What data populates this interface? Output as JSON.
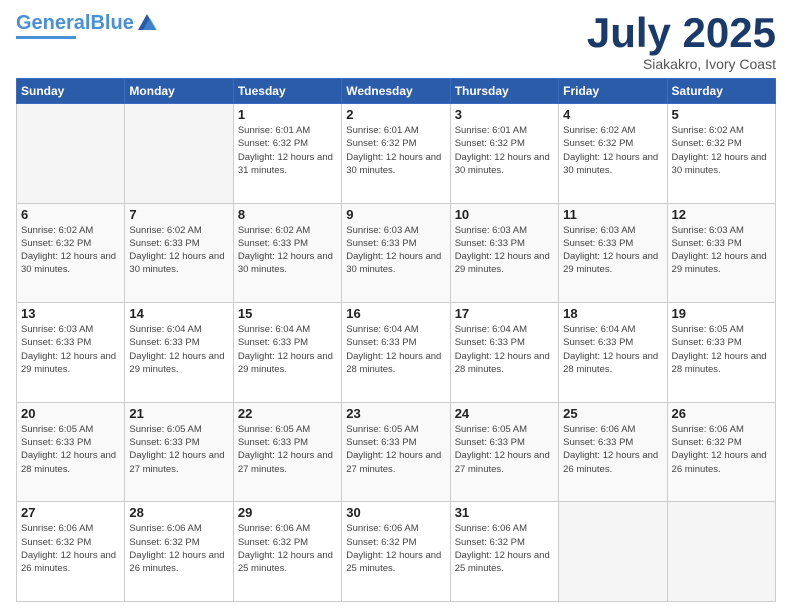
{
  "header": {
    "logo_general": "General",
    "logo_blue": "Blue",
    "month_title": "July 2025",
    "location": "Siakakro, Ivory Coast"
  },
  "days_of_week": [
    "Sunday",
    "Monday",
    "Tuesday",
    "Wednesday",
    "Thursday",
    "Friday",
    "Saturday"
  ],
  "weeks": [
    [
      {
        "day": "",
        "info": ""
      },
      {
        "day": "",
        "info": ""
      },
      {
        "day": "1",
        "sunrise": "6:01 AM",
        "sunset": "6:32 PM",
        "daylight": "12 hours and 31 minutes."
      },
      {
        "day": "2",
        "sunrise": "6:01 AM",
        "sunset": "6:32 PM",
        "daylight": "12 hours and 30 minutes."
      },
      {
        "day": "3",
        "sunrise": "6:01 AM",
        "sunset": "6:32 PM",
        "daylight": "12 hours and 30 minutes."
      },
      {
        "day": "4",
        "sunrise": "6:02 AM",
        "sunset": "6:32 PM",
        "daylight": "12 hours and 30 minutes."
      },
      {
        "day": "5",
        "sunrise": "6:02 AM",
        "sunset": "6:32 PM",
        "daylight": "12 hours and 30 minutes."
      }
    ],
    [
      {
        "day": "6",
        "sunrise": "6:02 AM",
        "sunset": "6:32 PM",
        "daylight": "12 hours and 30 minutes."
      },
      {
        "day": "7",
        "sunrise": "6:02 AM",
        "sunset": "6:33 PM",
        "daylight": "12 hours and 30 minutes."
      },
      {
        "day": "8",
        "sunrise": "6:02 AM",
        "sunset": "6:33 PM",
        "daylight": "12 hours and 30 minutes."
      },
      {
        "day": "9",
        "sunrise": "6:03 AM",
        "sunset": "6:33 PM",
        "daylight": "12 hours and 30 minutes."
      },
      {
        "day": "10",
        "sunrise": "6:03 AM",
        "sunset": "6:33 PM",
        "daylight": "12 hours and 29 minutes."
      },
      {
        "day": "11",
        "sunrise": "6:03 AM",
        "sunset": "6:33 PM",
        "daylight": "12 hours and 29 minutes."
      },
      {
        "day": "12",
        "sunrise": "6:03 AM",
        "sunset": "6:33 PM",
        "daylight": "12 hours and 29 minutes."
      }
    ],
    [
      {
        "day": "13",
        "sunrise": "6:03 AM",
        "sunset": "6:33 PM",
        "daylight": "12 hours and 29 minutes."
      },
      {
        "day": "14",
        "sunrise": "6:04 AM",
        "sunset": "6:33 PM",
        "daylight": "12 hours and 29 minutes."
      },
      {
        "day": "15",
        "sunrise": "6:04 AM",
        "sunset": "6:33 PM",
        "daylight": "12 hours and 29 minutes."
      },
      {
        "day": "16",
        "sunrise": "6:04 AM",
        "sunset": "6:33 PM",
        "daylight": "12 hours and 28 minutes."
      },
      {
        "day": "17",
        "sunrise": "6:04 AM",
        "sunset": "6:33 PM",
        "daylight": "12 hours and 28 minutes."
      },
      {
        "day": "18",
        "sunrise": "6:04 AM",
        "sunset": "6:33 PM",
        "daylight": "12 hours and 28 minutes."
      },
      {
        "day": "19",
        "sunrise": "6:05 AM",
        "sunset": "6:33 PM",
        "daylight": "12 hours and 28 minutes."
      }
    ],
    [
      {
        "day": "20",
        "sunrise": "6:05 AM",
        "sunset": "6:33 PM",
        "daylight": "12 hours and 28 minutes."
      },
      {
        "day": "21",
        "sunrise": "6:05 AM",
        "sunset": "6:33 PM",
        "daylight": "12 hours and 27 minutes."
      },
      {
        "day": "22",
        "sunrise": "6:05 AM",
        "sunset": "6:33 PM",
        "daylight": "12 hours and 27 minutes."
      },
      {
        "day": "23",
        "sunrise": "6:05 AM",
        "sunset": "6:33 PM",
        "daylight": "12 hours and 27 minutes."
      },
      {
        "day": "24",
        "sunrise": "6:05 AM",
        "sunset": "6:33 PM",
        "daylight": "12 hours and 27 minutes."
      },
      {
        "day": "25",
        "sunrise": "6:06 AM",
        "sunset": "6:33 PM",
        "daylight": "12 hours and 26 minutes."
      },
      {
        "day": "26",
        "sunrise": "6:06 AM",
        "sunset": "6:32 PM",
        "daylight": "12 hours and 26 minutes."
      }
    ],
    [
      {
        "day": "27",
        "sunrise": "6:06 AM",
        "sunset": "6:32 PM",
        "daylight": "12 hours and 26 minutes."
      },
      {
        "day": "28",
        "sunrise": "6:06 AM",
        "sunset": "6:32 PM",
        "daylight": "12 hours and 26 minutes."
      },
      {
        "day": "29",
        "sunrise": "6:06 AM",
        "sunset": "6:32 PM",
        "daylight": "12 hours and 25 minutes."
      },
      {
        "day": "30",
        "sunrise": "6:06 AM",
        "sunset": "6:32 PM",
        "daylight": "12 hours and 25 minutes."
      },
      {
        "day": "31",
        "sunrise": "6:06 AM",
        "sunset": "6:32 PM",
        "daylight": "12 hours and 25 minutes."
      },
      {
        "day": "",
        "info": ""
      },
      {
        "day": "",
        "info": ""
      }
    ]
  ]
}
